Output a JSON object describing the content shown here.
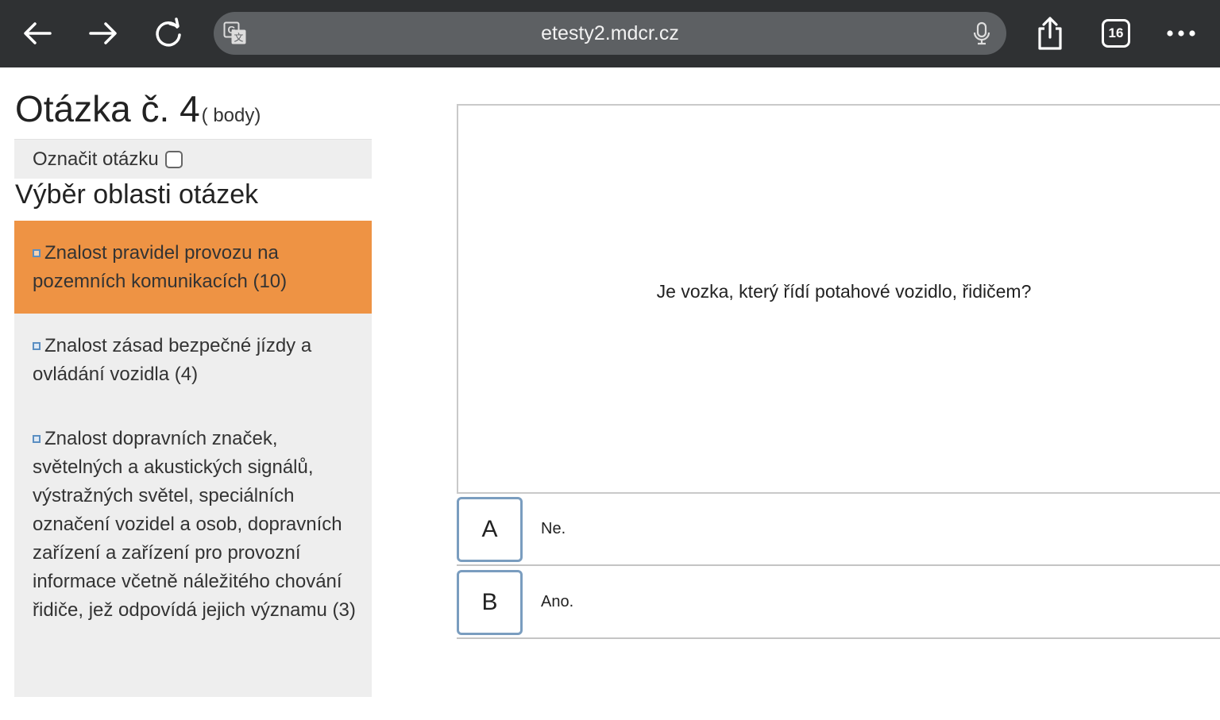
{
  "browser": {
    "url": "etesty2.mdcr.cz",
    "tab_count": "16",
    "icons": {
      "back": "arrow-left-icon",
      "forward": "arrow-right-icon",
      "reload": "reload-icon",
      "translate": "translate-icon",
      "mic": "microphone-icon",
      "share": "share-icon",
      "tabs": "tabs-icon",
      "more": "more-icon"
    },
    "colors": {
      "toolbar": "#2f3133",
      "address_bar": "#5d6063"
    }
  },
  "question": {
    "title": "Otázka č. 4",
    "points": "( body)",
    "mark_label": "Označit otázku",
    "text": "Je vozka, který řídí potahové vozidlo, řidičem?"
  },
  "sidebar": {
    "heading": "Výběr oblasti otázek",
    "active_color": "#ee9344",
    "topics": [
      {
        "label": "Znalost pravidel provozu na pozemních komunikacích (10)",
        "active": true
      },
      {
        "label": "Znalost zásad bezpečné jízdy a ovládání vozidla (4)",
        "active": false
      },
      {
        "label": "Znalost dopravních značek, světelných a akustických signálů, výstražných světel, speciálních označení vozidel a osob, dopravních zařízení a zařízení pro provozní informace včetně náležitého chování řidiče, jež odpovídá jejich významu (3)",
        "active": false
      }
    ]
  },
  "answers": [
    {
      "letter": "A",
      "text": "Ne."
    },
    {
      "letter": "B",
      "text": "Ano."
    }
  ]
}
